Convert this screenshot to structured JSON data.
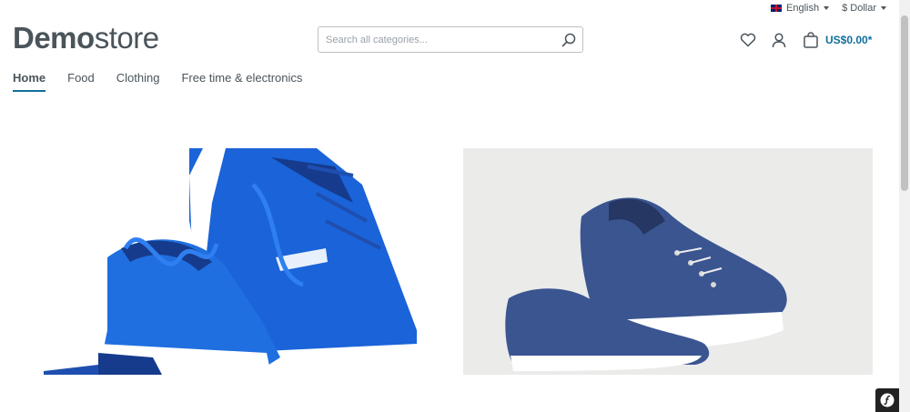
{
  "topbar": {
    "language": "English",
    "currency": "$ Dollar"
  },
  "logo": {
    "bold": "Demo",
    "regular": "store"
  },
  "search": {
    "placeholder": "Search all categories..."
  },
  "cart": {
    "total": "US$0.00*"
  },
  "nav": {
    "items": [
      {
        "label": "Home"
      },
      {
        "label": "Food"
      },
      {
        "label": "Clothing"
      },
      {
        "label": "Free time & electronics"
      }
    ]
  },
  "colors": {
    "accent": "#0f6f9b",
    "text": "#4a545b",
    "shoe_left": "#1a63d8",
    "shoe_right": "#3b5591"
  },
  "icons": {
    "search": "search-icon",
    "wishlist": "heart-icon",
    "account": "user-icon",
    "cart": "shopping-bag-icon",
    "flag": "uk-flag-icon",
    "symfony": "symfony-icon"
  }
}
